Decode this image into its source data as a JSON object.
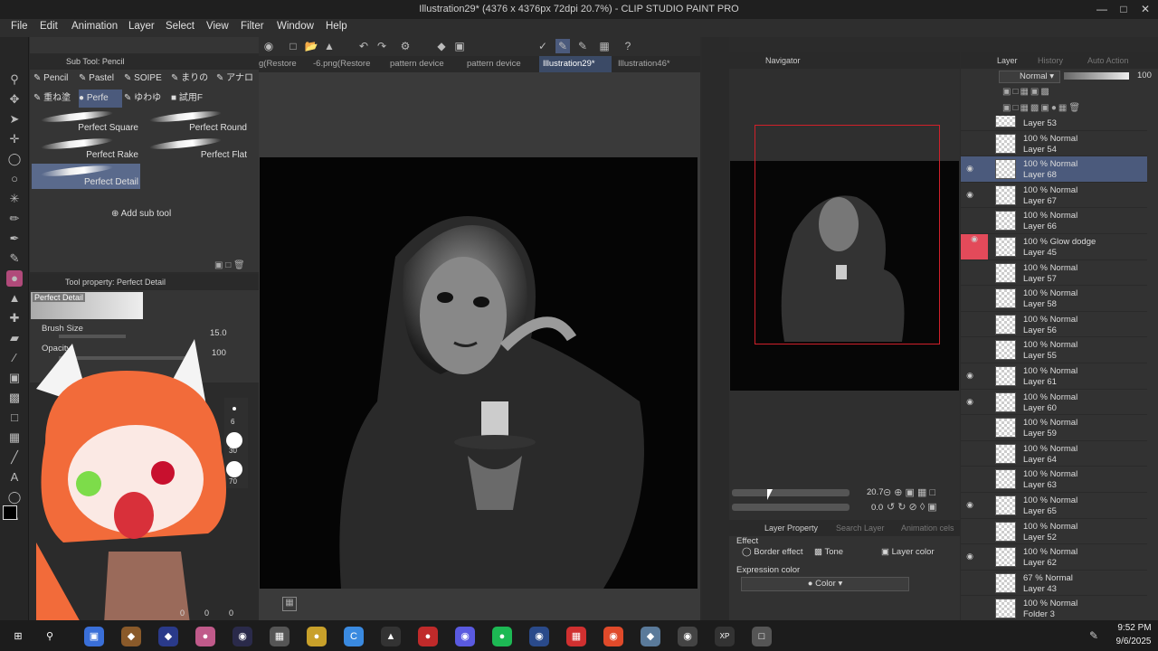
{
  "window": {
    "title": "Illustration29* (4376 x 4376px 72dpi 20.7%) - CLIP STUDIO PAINT PRO"
  },
  "menu": [
    "File",
    "Edit",
    "Animation",
    "Layer",
    "Select",
    "View",
    "Filter",
    "Window",
    "Help"
  ],
  "subtool": {
    "header": "Sub Tool: Pencil",
    "tabs_row1": [
      "Pencil",
      "Pastel",
      "SOIPE",
      "まりの",
      "アナロ"
    ],
    "tabs_row2": [
      "重ね塗",
      "Perfe",
      "ゆわゆ",
      "試用F"
    ],
    "brushes": [
      "Perfect Square",
      "Perfect Round",
      "Perfect Rake",
      "Perfect Flat",
      "Perfect Detail"
    ],
    "add_label": "Add sub tool"
  },
  "toolprop": {
    "header": "Tool property: Perfect Detail",
    "preset": "Perfect Detail",
    "brush_size_label": "Brush Size",
    "brush_size_value": "15.0",
    "opacity_label": "Opacity",
    "opacity_value": "100"
  },
  "brush_sizes": [
    "6",
    "30",
    "70"
  ],
  "color_values": [
    "0",
    "0",
    "0"
  ],
  "doc_tabs": [
    "g(Restore",
    "-6.png(Restore",
    "pattern device",
    "pattern device",
    "Illustration29*",
    "Illustration46*"
  ],
  "navigator": {
    "tabs": [
      "Navigator"
    ],
    "zoom": "20.7",
    "angle": "0.0"
  },
  "layerprop": {
    "tabs": [
      "Layer Property",
      "Search Layer",
      "Animation cels"
    ],
    "effect_label": "Effect",
    "effects": [
      "Border effect",
      "Tone",
      "Layer color"
    ],
    "expr_label": "Expression color",
    "expr_value": "Color"
  },
  "layers": {
    "tabs": [
      "Layer",
      "History",
      "Auto Action"
    ],
    "blend_mode": "Normal",
    "opacity": "100",
    "items": [
      {
        "blend": "",
        "name": "Layer 53"
      },
      {
        "blend": "100 % Normal",
        "name": "Layer 54"
      },
      {
        "blend": "100 % Normal",
        "name": "Layer 68"
      },
      {
        "blend": "100 % Normal",
        "name": "Layer 67"
      },
      {
        "blend": "100 % Normal",
        "name": "Layer 66"
      },
      {
        "blend": "100 % Glow dodge",
        "name": "Layer 45"
      },
      {
        "blend": "100 % Normal",
        "name": "Layer 57"
      },
      {
        "blend": "100 % Normal",
        "name": "Layer 58"
      },
      {
        "blend": "100 % Normal",
        "name": "Layer 56"
      },
      {
        "blend": "100 % Normal",
        "name": "Layer 55"
      },
      {
        "blend": "100 % Normal",
        "name": "Layer 61"
      },
      {
        "blend": "100 % Normal",
        "name": "Layer 60"
      },
      {
        "blend": "100 % Normal",
        "name": "Layer 59"
      },
      {
        "blend": "100 % Normal",
        "name": "Layer 64"
      },
      {
        "blend": "100 % Normal",
        "name": "Layer 63"
      },
      {
        "blend": "100 % Normal",
        "name": "Layer 65"
      },
      {
        "blend": "100 % Normal",
        "name": "Layer 52"
      },
      {
        "blend": "100 % Normal",
        "name": "Layer 62"
      },
      {
        "blend": "67 % Normal",
        "name": "Layer 43"
      },
      {
        "blend": "100 % Normal",
        "name": "Folder 3"
      }
    ]
  },
  "taskbar": {
    "time": "9:52 PM",
    "date": "9/6/2025"
  },
  "colors": {
    "accent": "#4b5a7c",
    "active_tab": "#3b4a66",
    "glow_layer": "#e34a5a"
  }
}
